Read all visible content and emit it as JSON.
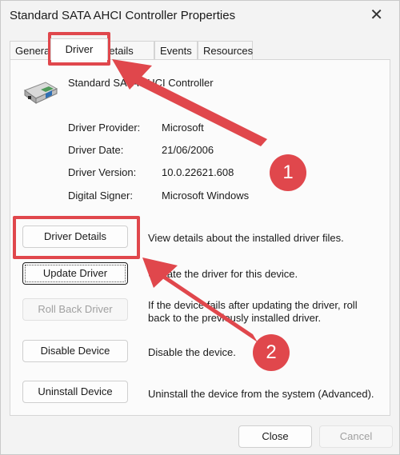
{
  "window": {
    "title": "Standard SATA AHCI Controller Properties",
    "close_glyph": "✕"
  },
  "tabs": [
    {
      "label": "General"
    },
    {
      "label": "Driver"
    },
    {
      "label": "Details"
    },
    {
      "label": "Events"
    },
    {
      "label": "Resources"
    }
  ],
  "device": {
    "name": "Standard SATA AHCI Controller",
    "icon": "storage-controller-icon"
  },
  "info": {
    "provider_label": "Driver Provider:",
    "provider_value": "Microsoft",
    "date_label": "Driver Date:",
    "date_value": "21/06/2006",
    "version_label": "Driver Version:",
    "version_value": "10.0.22621.608",
    "signer_label": "Digital Signer:",
    "signer_value": "Microsoft Windows"
  },
  "actions": {
    "details_label": "Driver Details",
    "details_desc": "View details about the installed driver files.",
    "update_label": "Update Driver",
    "update_desc": "Update the driver for this device.",
    "rollback_label": "Roll Back Driver",
    "rollback_desc_1": "If the device fails after updating the driver, roll",
    "rollback_desc_2": "back to the previously installed driver.",
    "disable_label": "Disable Device",
    "disable_desc": "Disable the device.",
    "uninstall_label": "Uninstall Device",
    "uninstall_desc": "Uninstall the device from the system (Advanced)."
  },
  "footer": {
    "close_label": "Close",
    "cancel_label": "Cancel"
  },
  "annotations": {
    "badge_1": "1",
    "badge_2": "2",
    "accent_color": "#e0474c"
  }
}
